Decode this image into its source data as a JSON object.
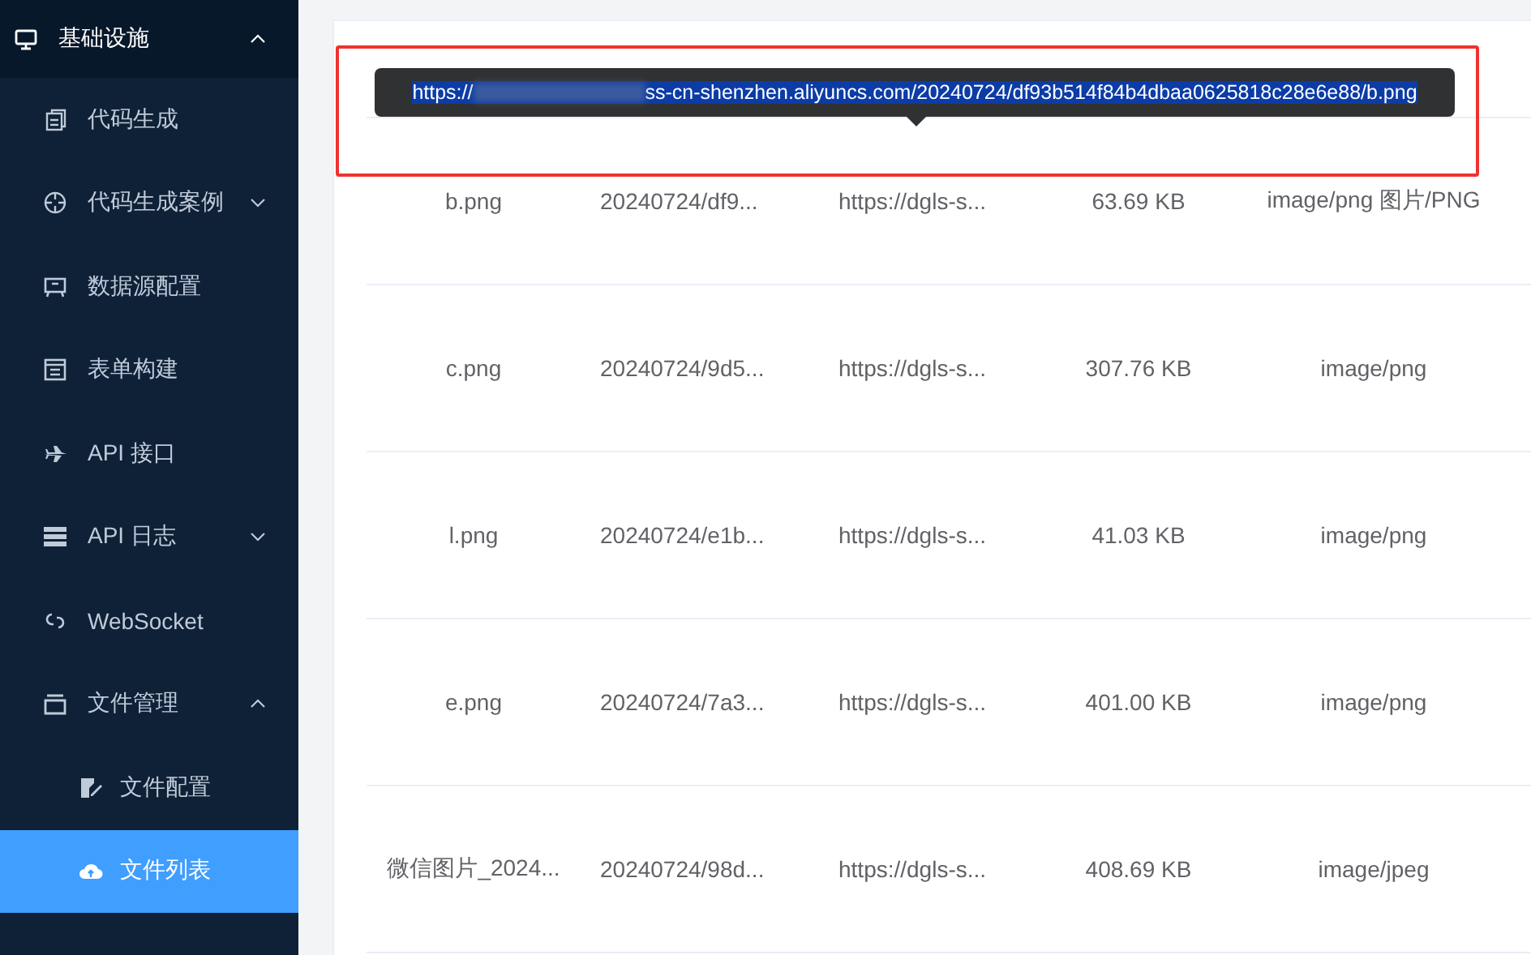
{
  "sidebar": {
    "items": [
      {
        "label": "基础设施",
        "expanded": true,
        "selected": false,
        "children": [
          {
            "label": "代码生成",
            "selected": false
          },
          {
            "label": "代码生成案例",
            "expanded": false,
            "selected": false
          },
          {
            "label": "数据源配置",
            "selected": false
          },
          {
            "label": "表单构建",
            "selected": false
          },
          {
            "label": "API 接口",
            "selected": false
          },
          {
            "label": "API 日志",
            "expanded": false,
            "selected": false
          },
          {
            "label": "WebSocket",
            "selected": false
          },
          {
            "label": "文件管理",
            "expanded": true,
            "selected": false,
            "children": [
              {
                "label": "文件配置",
                "selected": false
              },
              {
                "label": "文件列表",
                "selected": true
              }
            ]
          }
        ]
      }
    ]
  },
  "table": {
    "rows": [
      [
        "b.png",
        "20240724/df9...",
        "https://dgls-s...",
        "63.69 KB",
        "image/png 图片/PNG"
      ],
      [
        "c.png",
        "20240724/9d5...",
        "https://dgls-s...",
        "307.76 KB",
        "image/png"
      ],
      [
        "l.png",
        "20240724/e1b...",
        "https://dgls-s...",
        "41.03 KB",
        "image/png"
      ],
      [
        "e.png",
        "20240724/7a3...",
        "https://dgls-s...",
        "401.00 KB",
        "image/png"
      ],
      [
        "微信图片_2024...",
        "20240724/98d...",
        "https://dgls-s...",
        "408.69 KB",
        "image/jpeg"
      ]
    ]
  },
  "tooltip": {
    "prefix": "https://",
    "text": "ss-cn-shenzhen.aliyuncs.com/20240724/df93b514f84b4dbaa0625818c28e6e88/b.png",
    "selected": true
  }
}
